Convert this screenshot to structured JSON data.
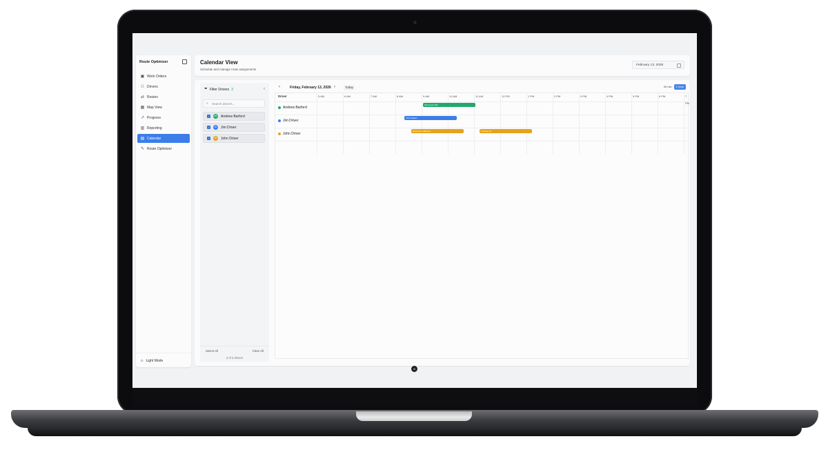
{
  "sidebar": {
    "brand": "Route Optimizer",
    "items": [
      {
        "label": "Work Orders",
        "icon": "briefcase-icon",
        "glyph": "▣"
      },
      {
        "label": "Drivers",
        "icon": "users-icon",
        "glyph": "⚇"
      },
      {
        "label": "Routes",
        "icon": "route-icon",
        "glyph": "⇄"
      },
      {
        "label": "Map View",
        "icon": "map-icon",
        "glyph": "▦"
      },
      {
        "label": "Progress",
        "icon": "trend-icon",
        "glyph": "↗"
      },
      {
        "label": "Reporting",
        "icon": "chart-icon",
        "glyph": "▥"
      },
      {
        "label": "Calendar",
        "icon": "calendar-icon",
        "glyph": "▤",
        "active": true
      },
      {
        "label": "Route Optimizer",
        "icon": "wrench-icon",
        "glyph": "✎"
      }
    ],
    "light_mode": "Light Mode"
  },
  "header": {
    "title": "Calendar View",
    "subtitle": "Schedule and manage route assignments",
    "date_value": "February 13, 2026"
  },
  "filter": {
    "title": "Filter Drivers",
    "count": "3",
    "search_placeholder": "Search drivers...",
    "drivers": [
      {
        "name": "Andrew Barford",
        "initials": "AB",
        "color": "#22a86c"
      },
      {
        "name": "Jim Driver",
        "initials": "JD",
        "color": "#3b7de9"
      },
      {
        "name": "John Driver",
        "initials": "JD",
        "color": "#e8a21a"
      }
    ],
    "select_all": "Select All",
    "clear_all": "Clear All",
    "drivers_count": "3 of 3 drivers"
  },
  "calendar": {
    "date_label": "Friday, February 13, 2026",
    "today": "Today",
    "views": [
      "30 min",
      "1 hour"
    ],
    "active_view": "1 hour",
    "driver_col": "Driver",
    "hours": [
      "5 AM",
      "6 AM",
      "7 AM",
      "8 AM",
      "9 AM",
      "10 AM",
      "11 AM",
      "12 PM",
      "1 PM",
      "2 PM",
      "3 PM",
      "4 PM",
      "5 PM",
      "6 PM",
      "7 PM"
    ],
    "rows": [
      {
        "driver": "Andrew Barford",
        "color": "#22a86c",
        "bars": [
          {
            "label": "Vancouver-WA",
            "start": 9.05,
            "end": 11.05
          }
        ]
      },
      {
        "driver": "Jim Driver",
        "color": "#3b7de9",
        "bars": [
          {
            "label": "OR-Tualatin",
            "start": 8.35,
            "end": 10.35
          }
        ]
      },
      {
        "driver": "John Driver",
        "color": "#e8a21a",
        "bars": [
          {
            "label": "Beaverton-Hillsboro",
            "start": 8.6,
            "end": 10.6
          },
          {
            "label": "Gresham-E",
            "start": 11.2,
            "end": 13.2
          }
        ]
      }
    ]
  }
}
